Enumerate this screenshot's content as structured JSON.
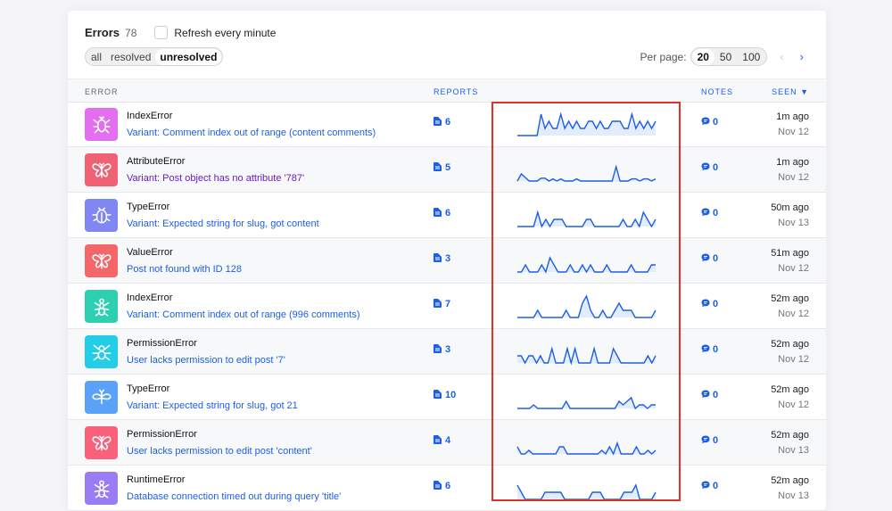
{
  "header": {
    "title": "Errors",
    "count": "78",
    "refresh_label": "Refresh every minute"
  },
  "filters": [
    {
      "label": "all",
      "active": false
    },
    {
      "label": "resolved",
      "active": false
    },
    {
      "label": "unresolved",
      "active": true
    }
  ],
  "per_page": {
    "label": "Per page:",
    "options": [
      "20",
      "50",
      "100"
    ],
    "selected": "20",
    "prev": "‹",
    "next": "›"
  },
  "columns": {
    "error": "ERROR",
    "reports": "REPORTS",
    "notes": "NOTES",
    "seen": "SEEN ▼"
  },
  "rows": [
    {
      "name": "IndexError",
      "variant": "Variant: Comment index out of range (content comments)",
      "visited": false,
      "icon": "bug-icon",
      "color": "#e36ff0",
      "reports": "6",
      "notes": "0",
      "seen": "1m ago",
      "date": "Nov 12",
      "spark": [
        0,
        0,
        0,
        0,
        0,
        0,
        3,
        1,
        2,
        1,
        1,
        3,
        1,
        2,
        1,
        2,
        1,
        1,
        2,
        2,
        1,
        2,
        1,
        1,
        2,
        2,
        2,
        1,
        1,
        3,
        1,
        2,
        1,
        2,
        1,
        2
      ]
    },
    {
      "name": "AttributeError",
      "variant": "Variant: Post object has no attribute '787'",
      "visited": true,
      "icon": "butterfly-icon",
      "color": "#f06173",
      "reports": "5",
      "notes": "0",
      "seen": "1m ago",
      "date": "Nov 12",
      "spark": [
        0,
        1,
        0.5,
        0,
        0,
        0,
        0.4,
        0.4,
        0,
        0.3,
        0,
        0.3,
        0,
        0,
        0,
        0.3,
        0,
        0,
        0,
        0,
        0,
        0,
        0,
        0,
        0,
        2,
        0,
        0,
        0,
        0.3,
        0.3,
        0,
        0.3,
        0.3,
        0,
        0.3
      ]
    },
    {
      "name": "TypeError",
      "variant": "Variant: Expected string for slug, got content",
      "visited": false,
      "icon": "beetle-icon",
      "color": "#8087f2",
      "reports": "6",
      "notes": "0",
      "seen": "50m ago",
      "date": "Nov 13",
      "spark": [
        0,
        0,
        0,
        0,
        0,
        2,
        0,
        1,
        0,
        1,
        1,
        1,
        0,
        0,
        0,
        0,
        0,
        1,
        1,
        0,
        0,
        0,
        0,
        0,
        0,
        0,
        1,
        0,
        0,
        1,
        0,
        2,
        1,
        0,
        1
      ]
    },
    {
      "name": "ValueError",
      "variant": "Post not found with ID 128",
      "visited": false,
      "icon": "butterfly-icon",
      "color": "#f46668",
      "reports": "3",
      "notes": "0",
      "seen": "51m ago",
      "date": "Nov 12",
      "spark": [
        0,
        0,
        1,
        0,
        0,
        0,
        1,
        0,
        2,
        1,
        0,
        0,
        0,
        1,
        0,
        0,
        1,
        0,
        1,
        0,
        0,
        0,
        1,
        0,
        0,
        0,
        0,
        0,
        1,
        0,
        0,
        0,
        0,
        1,
        1
      ]
    },
    {
      "name": "IndexError",
      "variant": "Variant: Comment index out of range (996 comments)",
      "visited": false,
      "icon": "ant-icon",
      "color": "#2ccfb0",
      "reports": "7",
      "notes": "0",
      "seen": "52m ago",
      "date": "Nov 12",
      "spark": [
        0,
        0,
        0,
        0,
        0,
        1,
        0,
        0,
        0,
        0,
        0,
        0,
        1,
        0,
        0,
        0,
        2,
        3,
        1,
        0,
        0,
        1,
        0,
        0,
        1,
        2,
        1,
        1,
        1,
        0,
        0,
        0,
        0,
        0,
        1
      ]
    },
    {
      "name": "PermissionError",
      "variant": "User lacks permission to edit post '7'",
      "visited": false,
      "icon": "spider-icon",
      "color": "#22cde8",
      "reports": "3",
      "notes": "0",
      "seen": "52m ago",
      "date": "Nov 12",
      "spark": [
        1,
        1,
        0,
        1,
        1,
        0,
        1,
        0,
        0,
        2,
        0,
        0,
        0,
        2,
        0,
        2,
        0,
        0,
        0,
        0,
        2,
        0,
        0,
        0,
        0,
        2,
        1,
        0,
        0,
        0,
        0,
        0,
        0,
        0,
        1,
        0,
        1
      ]
    },
    {
      "name": "TypeError",
      "variant": "Variant: Expected string for slug, got 21",
      "visited": false,
      "icon": "moth-icon",
      "color": "#5aa2f7",
      "reports": "10",
      "notes": "0",
      "seen": "52m ago",
      "date": "Nov 12",
      "spark": [
        0,
        0,
        0,
        0,
        0.5,
        0,
        0,
        0,
        0,
        0,
        0,
        0,
        1,
        0,
        0,
        0,
        0,
        0,
        0,
        0,
        0,
        0,
        0,
        0,
        0,
        1,
        0.5,
        1,
        1.5,
        0,
        0.5,
        0.5,
        0,
        0.5,
        0.5
      ]
    },
    {
      "name": "PermissionError",
      "variant": "User lacks permission to edit post 'content'",
      "visited": false,
      "icon": "butterfly-icon",
      "color": "#f9607a",
      "reports": "4",
      "notes": "0",
      "seen": "52m ago",
      "date": "Nov 13",
      "spark": [
        1,
        0,
        0,
        0.5,
        0,
        0,
        0,
        0,
        0,
        0,
        0,
        1,
        1,
        0,
        0,
        0,
        0,
        0,
        0,
        0,
        0,
        0,
        0.5,
        0,
        1,
        0,
        1.5,
        0,
        0,
        0,
        0,
        1,
        0,
        0,
        0.5,
        0,
        0.5
      ]
    },
    {
      "name": "RuntimeError",
      "variant": "Database connection timed out during query 'title'",
      "visited": false,
      "icon": "ant-icon",
      "color": "#9a7cf4",
      "reports": "6",
      "notes": "0",
      "seen": "52m ago",
      "date": "Nov 13",
      "spark": [
        2,
        1,
        0,
        0,
        0,
        0,
        0,
        1,
        1,
        1,
        1,
        1,
        0,
        0,
        0,
        0,
        0,
        0,
        0,
        1,
        1,
        1,
        0,
        0,
        0,
        0,
        0,
        1,
        1,
        1,
        2,
        0,
        0,
        0,
        0,
        1
      ]
    }
  ]
}
